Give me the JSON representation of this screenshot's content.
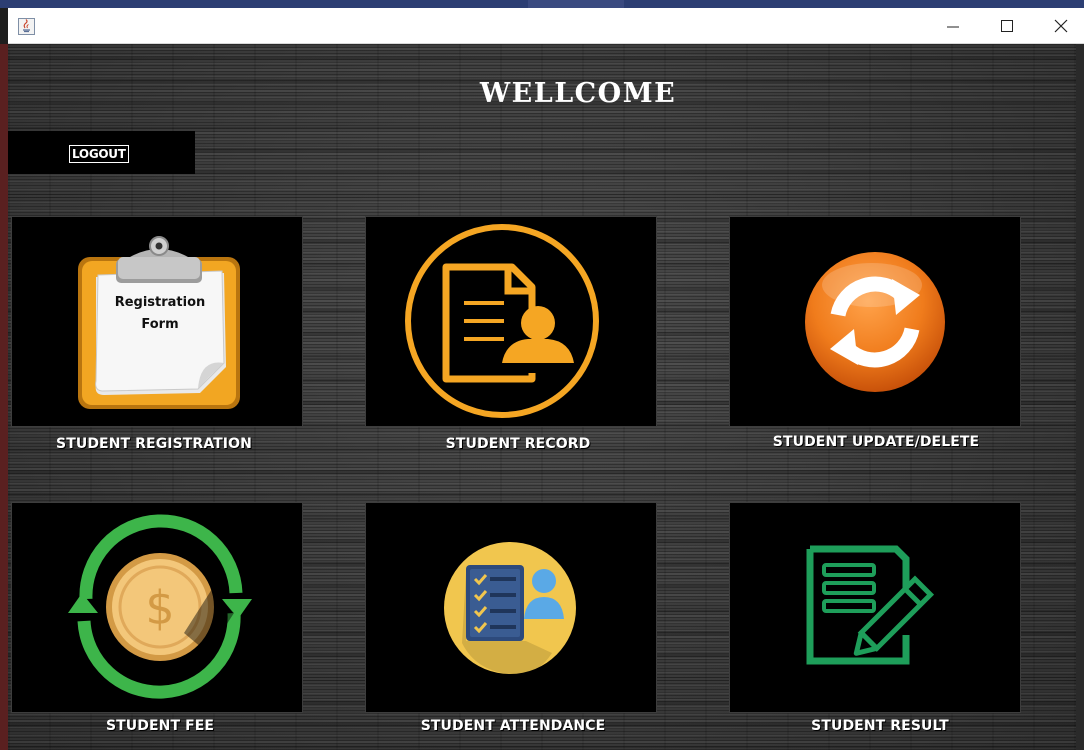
{
  "window": {
    "title": "",
    "controls": {
      "minimize": "minimize-icon",
      "maximize": "maximize-icon",
      "close": "close-icon"
    }
  },
  "header": {
    "title": "WELLCOME"
  },
  "actions": {
    "logout_label": "LOGOUT"
  },
  "tiles": [
    {
      "label": "STUDENT REGISTRATION",
      "icon": "registration-form-clipboard-icon",
      "icon_text": [
        "Registration",
        "Form"
      ],
      "accent": "#f2a622"
    },
    {
      "label": "STUDENT RECORD",
      "icon": "student-record-document-icon",
      "accent": "#f5a623"
    },
    {
      "label": "STUDENT UPDATE/DELETE",
      "icon": "refresh-arrows-icon",
      "accent": "#f07c1c"
    },
    {
      "label": "STUDENT FEE",
      "icon": "coin-dollar-cycle-icon",
      "accent": "#3db54a"
    },
    {
      "label": "STUDENT ATTENDANCE",
      "icon": "attendance-checklist-icon",
      "accent": "#f1c64e"
    },
    {
      "label": "STUDENT RESULT",
      "icon": "result-document-pencil-icon",
      "accent": "#1e9e5a"
    }
  ]
}
